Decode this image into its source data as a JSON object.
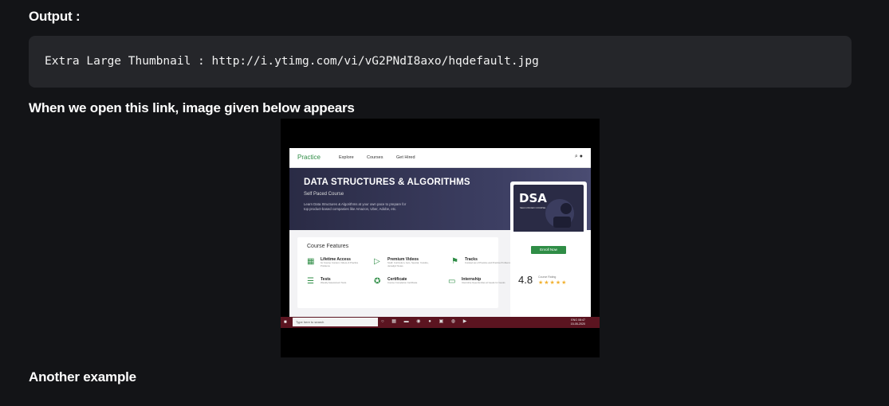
{
  "headings": {
    "output": "Output :",
    "when_open": "When we open this link, image given below appears",
    "another": "Another example"
  },
  "code_block": {
    "text": "Extra Large Thumbnail : http://i.ytimg.com/vi/vG2PNdI8axo/hqdefault.jpg"
  },
  "thumbnail": {
    "nav": {
      "brand": "Practice",
      "links": [
        "Explore",
        "Courses",
        "Get Hired"
      ]
    },
    "banner": {
      "title": "DATA STRUCTURES & ALGORITHMS",
      "subtitle": "Self Paced Course",
      "description": "Learn Data Structures & Algorithms at your own pace to prepare for top product-based companies like Amazon, Uber, Adobe, etc."
    },
    "card": {
      "big": "DSA",
      "sub": "SELF-PACED COURSE"
    },
    "enroll_label": "Enroll Now",
    "rating": {
      "value": "4.8",
      "label": "Course Rating",
      "stars": 5
    },
    "features": {
      "title": "Course Features",
      "items": [
        {
          "name": "Lifetime Access",
          "desc": "for Course Content, Videos & Practice Problems",
          "icon": "calendar-icon"
        },
        {
          "name": "Premium Videos",
          "desc": "Scaff, Curriculum, 1am, Special, Youtube, Jamaliyiz Notes",
          "icon": "play-icon"
        },
        {
          "name": "Tracks",
          "desc": "Curated set of Practice and Practice Problems",
          "icon": "flag-icon"
        },
        {
          "name": "Tests",
          "desc": "Weekly Assessment Tests",
          "icon": "checklist-icon"
        },
        {
          "name": "Certificate",
          "desc": "Course Completion Certificate",
          "icon": "award-icon"
        },
        {
          "name": "Internship",
          "desc": "Internship Opportunities at Geeks for Geeks",
          "icon": "briefcase-icon"
        }
      ]
    },
    "taskbar": {
      "search_placeholder": "Type here to search",
      "time": "08:47",
      "date": "15-05-2020",
      "lang": "ENG"
    }
  }
}
